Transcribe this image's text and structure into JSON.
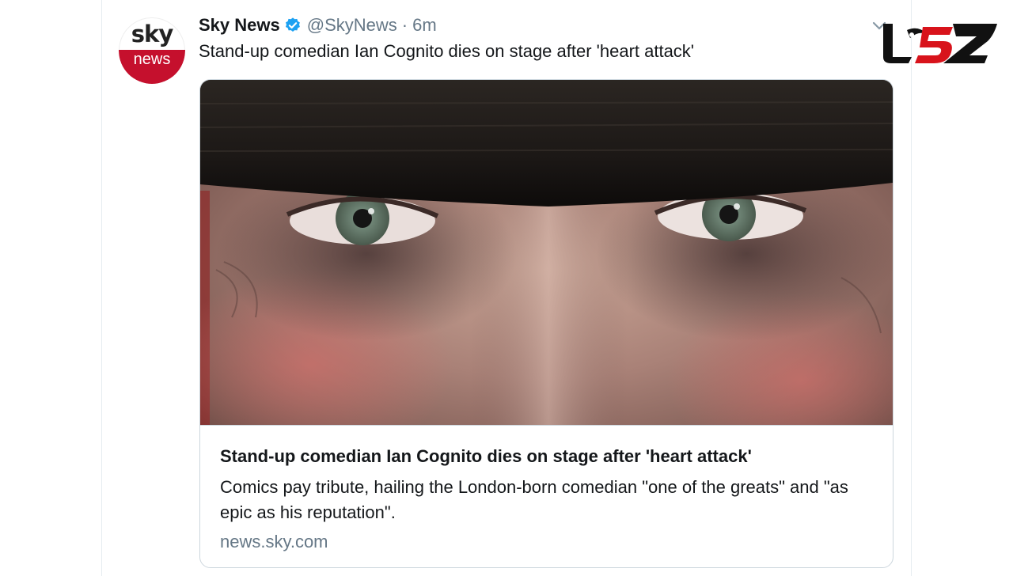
{
  "tweet": {
    "author_name": "Sky News",
    "author_handle": "@SkyNews",
    "separator": "·",
    "timestamp": "6m",
    "text": "Stand-up comedian Ian Cognito dies on stage after 'heart attack'",
    "verified": true
  },
  "avatar": {
    "line1": "sky",
    "line2": "news",
    "brand_color": "#c5102d"
  },
  "card": {
    "image_subject": "close-up of eyes beneath a dark hat brim",
    "title": "Stand-up comedian Ian Cognito dies on stage after 'heart attack'",
    "description": "Comics pay tribute, hailing the London-born comedian \"one of the greats\" and \"as epic as his reputation\".",
    "domain": "news.sky.com"
  },
  "icons": {
    "verified": "verified-badge-icon",
    "menu": "chevron-down-icon",
    "watermark": "brand-logo"
  },
  "colors": {
    "verified_blue": "#1da1f2",
    "secondary_text": "#657786",
    "watermark_red": "#d8131b"
  }
}
